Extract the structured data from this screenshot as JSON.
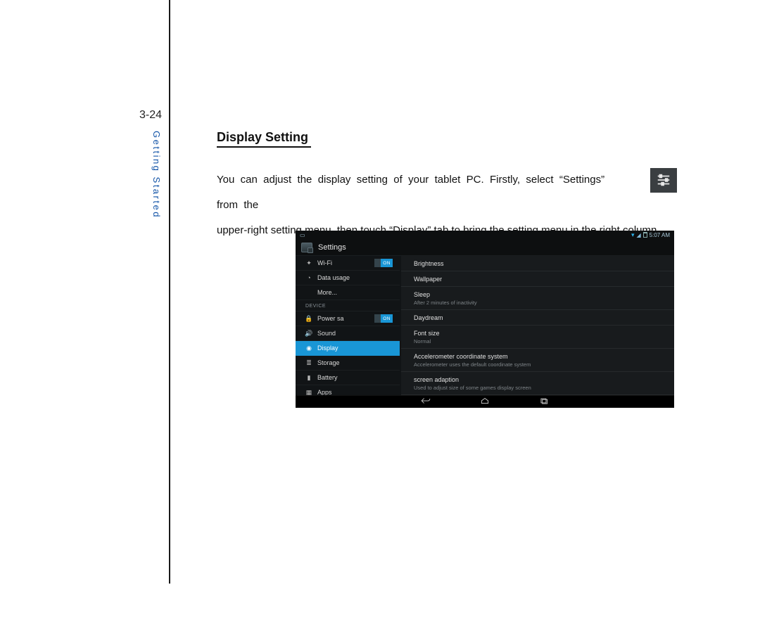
{
  "page_number": "3-24",
  "sidebar_label": "Getting Started",
  "heading": "Display Setting",
  "paragraph": {
    "p1_a": "You  can  adjust  the  display  setting  of  your  tablet  PC.  Firstly,  select  “Settings”",
    "p1_b": "from  the",
    "p2": "upper-right setting menu, then touch “Display” tab to bring the setting menu in the right column."
  },
  "settings_icon_name": "settings-sliders-icon",
  "tablet": {
    "status_time": "5:07 AM",
    "app_title": "Settings",
    "section_device": "DEVICE",
    "toggle_on": "ON",
    "sidebar_items": [
      {
        "icon": "wifi",
        "label": "Wi-Fi",
        "toggle": true
      },
      {
        "icon": "data",
        "label": "Data usage",
        "toggle": false
      },
      {
        "icon": "",
        "label": "More...",
        "toggle": false
      }
    ],
    "device_items": [
      {
        "icon": "power",
        "label": "Power sa",
        "toggle": true,
        "selected": false
      },
      {
        "icon": "sound",
        "label": "Sound",
        "toggle": false,
        "selected": false
      },
      {
        "icon": "display",
        "label": "Display",
        "toggle": false,
        "selected": true
      },
      {
        "icon": "storage",
        "label": "Storage",
        "toggle": false,
        "selected": false
      },
      {
        "icon": "battery",
        "label": "Battery",
        "toggle": false,
        "selected": false
      },
      {
        "icon": "apps",
        "label": "Apps",
        "toggle": false,
        "selected": false
      }
    ],
    "main_items": [
      {
        "title": "Brightness",
        "subtitle": ""
      },
      {
        "title": "Wallpaper",
        "subtitle": ""
      },
      {
        "title": "Sleep",
        "subtitle": "After 2 minutes of inactivity"
      },
      {
        "title": "Daydream",
        "subtitle": ""
      },
      {
        "title": "Font size",
        "subtitle": "Normal"
      },
      {
        "title": "Accelerometer coordinate system",
        "subtitle": "Accelerometer uses the default coordinate system"
      },
      {
        "title": "screen adaption",
        "subtitle": "Used to adjust size of some games display screen"
      }
    ]
  }
}
